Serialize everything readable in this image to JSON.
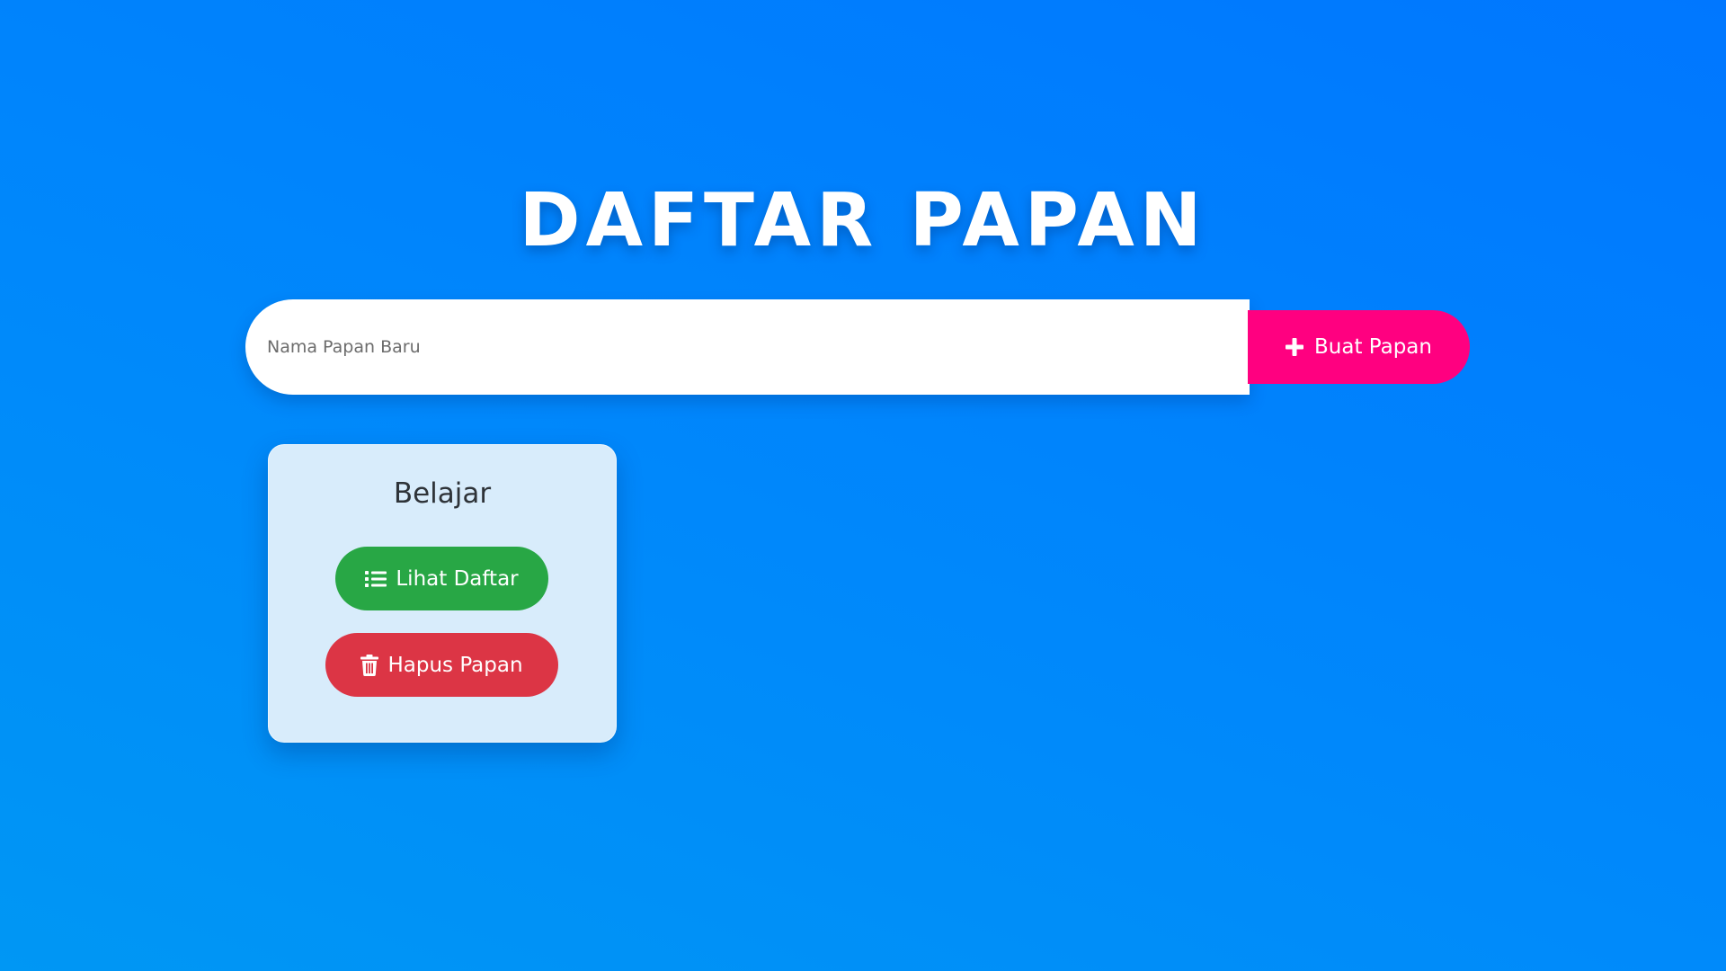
{
  "header": {
    "title": "DAFTAR PAPAN"
  },
  "create_form": {
    "input_placeholder": "Nama Papan Baru",
    "input_value": "",
    "button_label": "Buat Papan",
    "button_icon": "plus-icon"
  },
  "boards": [
    {
      "title": "Belajar",
      "view_label": "Lihat Daftar",
      "view_icon": "list-icon",
      "delete_label": "Hapus Papan",
      "delete_icon": "trash-icon"
    }
  ],
  "colors": {
    "background_top": "#0077ff",
    "background_bottom": "#0097f4",
    "create_button": "#ff0080",
    "card_background": "#d8ecfb",
    "view_button": "#28a745",
    "delete_button": "#dc3545"
  }
}
